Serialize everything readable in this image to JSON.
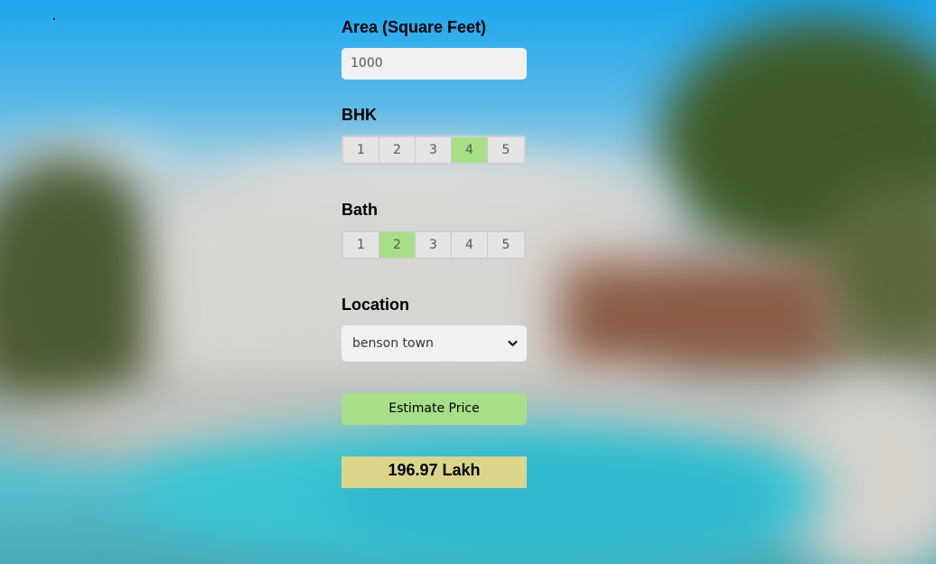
{
  "area": {
    "label": "Area (Square Feet)",
    "value": "1000"
  },
  "bhk": {
    "label": "BHK",
    "options": [
      "1",
      "2",
      "3",
      "4",
      "5"
    ],
    "selected": "4"
  },
  "bath": {
    "label": "Bath",
    "options": [
      "1",
      "2",
      "3",
      "4",
      "5"
    ],
    "selected": "2"
  },
  "location": {
    "label": "Location",
    "selected": "benson town"
  },
  "estimate_button": {
    "label": "Estimate Price"
  },
  "result": {
    "text": "196.97 Lakh"
  },
  "colors": {
    "active_option": "#a6df86",
    "button": "#a7df88",
    "result_bg": "#dbd58a"
  }
}
